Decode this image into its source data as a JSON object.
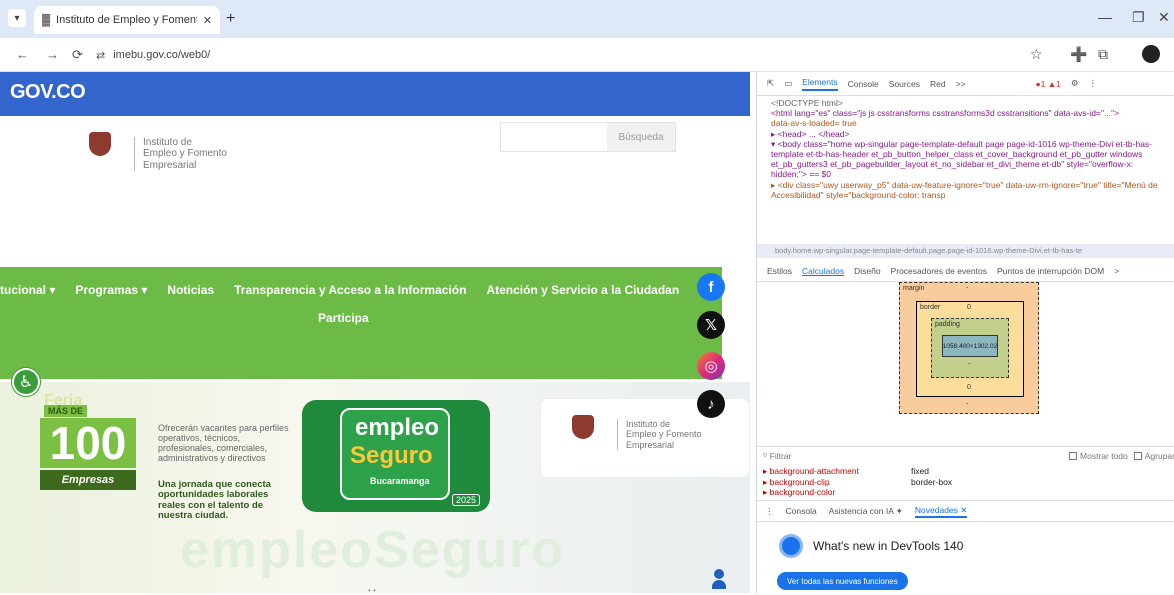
{
  "browser": {
    "tab_title": "Instituto de Empleo y Fomento...",
    "url": "imebu.gov.co/web0/",
    "icons": {
      "back": "←",
      "forward": "→",
      "reload": "⟳",
      "tune": "⇄",
      "star": "☆",
      "ext": "➕",
      "puzzle": "⧉",
      "minimize": "—",
      "restore": "❐",
      "close": "✕",
      "tab_menu": "▾",
      "tab_close": "✕",
      "new_tab": "+",
      "favicon": "▓"
    }
  },
  "site": {
    "gov_logo": "GOV.CO",
    "brand_lines": [
      "Instituto de",
      "Empleo y Fomento",
      "Empresarial"
    ],
    "search_button": "Búsqueda",
    "menu": [
      "tucional ▾",
      "Programas ▾",
      "Noticias",
      "Transparencia y Acceso a la Información",
      "Atención y Servicio a la Ciudadan"
    ],
    "menu_row2": "Participa",
    "a11y_icon": "♿",
    "social": {
      "facebook": "f",
      "x": "𝕏",
      "instagram": "◎",
      "tiktok": "♪"
    },
    "banner": {
      "feria": "Feria",
      "mas_de": "MÁS DE",
      "number": "100",
      "empresas": "Empresas",
      "promo_text": "Ofrecerán vacantes para perfiles operativos, técnicos, profesionales, comerciales, administrativos y directivos",
      "promo_bold": "Una jornada que conecta oportunidades laborales reales con el talento de nuestra ciudad.",
      "empleo": "empleo",
      "seguro": "Seguro",
      "city": "Bucaramanga",
      "year": "2025",
      "watermark": "empleoSeguro",
      "dots": "• •"
    }
  },
  "devtools": {
    "tabs": [
      "Elements",
      "Console",
      "Sources",
      "Red",
      ">>"
    ],
    "errors": "●1 ▲1",
    "dom_lines": [
      "<!DOCTYPE html>",
      "<html lang=\"es\" class=\"js js csstransforms csstransforms3d csstransitions\" data-avs-id=\"...\">",
      "data-av-s-loaded= true",
      "▸ <head> ... </head>",
      "▾ <body class=\"home wp-singular page-template-default page page-id-1016 wp-theme-Divi et-tb-has-template et-tb-has-header et_pb_button_helper_class et_cover_background et_pb_gutter windows et_pb_gutters3 et_pb_pagebuilder_layout et_no_sidebar et_divi_theme et-db\" style=\"overflow-x: hidden;\"> == $0",
      "▸ <div class=\"uwy userway_p5\" data-uw-feature-ignore=\"true\" data-uw-rm-ignore=\"true\" title=\"Menú de Accesibilidad\" style=\"background-color: transp"
    ],
    "breadcrumb": "body.home.wp-singular.page-template-default.page.page-id-1016.wp-theme-Divi.et-tb-has-te",
    "subtabs": [
      "Estilos",
      "Calculados",
      "Diseño",
      "Procesadores de eventos",
      "Puntos de interrupción DOM",
      ">"
    ],
    "boxmodel": {
      "margin": "margin",
      "border": "border",
      "padding": "padding",
      "content": "1058.400×1302.02",
      "dash": "-",
      "zero": "0"
    },
    "filter_placeholder": "Filtrar",
    "show_all": "Mostrar todo",
    "group": "Agrupar",
    "props": [
      {
        "k": "▸ background-attachment",
        "v": "fixed"
      },
      {
        "k": "▸ background-clip",
        "v": "border-box"
      },
      {
        "k": "▸ background-color",
        "v": ""
      }
    ],
    "drawer_tabs": [
      "⋮",
      "Consola",
      "Asistencia con IA ✦",
      "Novedades ✕"
    ],
    "whatsnew": "What's new in DevTools 140",
    "see_all": "Ver todas las nuevas funciones"
  },
  "colors": {
    "gov_blue": "#3366cc",
    "menu_green": "#6dbb47",
    "devtools_blue": "#1a73e8"
  }
}
